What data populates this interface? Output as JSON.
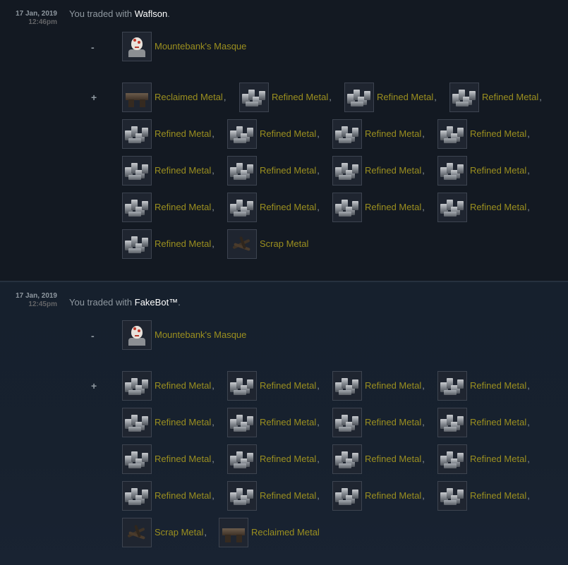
{
  "trades": [
    {
      "date": "17 Jan, 2019",
      "time": "12:46pm",
      "desc_prefix": "You traded with ",
      "partner": "Waflson",
      "desc_suffix": ".",
      "minus_sign": "-",
      "plus_sign": "+",
      "given": [
        {
          "name": "Mountebank's Masque",
          "icon": "masque-icon",
          "comma": ""
        }
      ],
      "received": [
        {
          "name": "Reclaimed Metal",
          "icon": "reclaimed-metal-icon",
          "comma": ","
        },
        {
          "name": "Refined Metal",
          "icon": "refined-metal-icon",
          "comma": ","
        },
        {
          "name": "Refined Metal",
          "icon": "refined-metal-icon",
          "comma": ","
        },
        {
          "name": "Refined Metal",
          "icon": "refined-metal-icon",
          "comma": ","
        },
        {
          "name": "Refined Metal",
          "icon": "refined-metal-icon",
          "comma": ","
        },
        {
          "name": "Refined Metal",
          "icon": "refined-metal-icon",
          "comma": ","
        },
        {
          "name": "Refined Metal",
          "icon": "refined-metal-icon",
          "comma": ","
        },
        {
          "name": "Refined Metal",
          "icon": "refined-metal-icon",
          "comma": ","
        },
        {
          "name": "Refined Metal",
          "icon": "refined-metal-icon",
          "comma": ","
        },
        {
          "name": "Refined Metal",
          "icon": "refined-metal-icon",
          "comma": ","
        },
        {
          "name": "Refined Metal",
          "icon": "refined-metal-icon",
          "comma": ","
        },
        {
          "name": "Refined Metal",
          "icon": "refined-metal-icon",
          "comma": ","
        },
        {
          "name": "Refined Metal",
          "icon": "refined-metal-icon",
          "comma": ","
        },
        {
          "name": "Refined Metal",
          "icon": "refined-metal-icon",
          "comma": ","
        },
        {
          "name": "Refined Metal",
          "icon": "refined-metal-icon",
          "comma": ","
        },
        {
          "name": "Refined Metal",
          "icon": "refined-metal-icon",
          "comma": ","
        },
        {
          "name": "Refined Metal",
          "icon": "refined-metal-icon",
          "comma": ","
        },
        {
          "name": "Scrap Metal",
          "icon": "scrap-metal-icon",
          "comma": ""
        }
      ]
    },
    {
      "date": "17 Jan, 2019",
      "time": "12:45pm",
      "desc_prefix": "You traded with ",
      "partner": "FakeBot™",
      "desc_suffix": ".",
      "minus_sign": "-",
      "plus_sign": "+",
      "given": [
        {
          "name": "Mountebank's Masque",
          "icon": "masque-icon",
          "comma": ""
        }
      ],
      "received": [
        {
          "name": "Refined Metal",
          "icon": "refined-metal-icon",
          "comma": ","
        },
        {
          "name": "Refined Metal",
          "icon": "refined-metal-icon",
          "comma": ","
        },
        {
          "name": "Refined Metal",
          "icon": "refined-metal-icon",
          "comma": ","
        },
        {
          "name": "Refined Metal",
          "icon": "refined-metal-icon",
          "comma": ","
        },
        {
          "name": "Refined Metal",
          "icon": "refined-metal-icon",
          "comma": ","
        },
        {
          "name": "Refined Metal",
          "icon": "refined-metal-icon",
          "comma": ","
        },
        {
          "name": "Refined Metal",
          "icon": "refined-metal-icon",
          "comma": ","
        },
        {
          "name": "Refined Metal",
          "icon": "refined-metal-icon",
          "comma": ","
        },
        {
          "name": "Refined Metal",
          "icon": "refined-metal-icon",
          "comma": ","
        },
        {
          "name": "Refined Metal",
          "icon": "refined-metal-icon",
          "comma": ","
        },
        {
          "name": "Refined Metal",
          "icon": "refined-metal-icon",
          "comma": ","
        },
        {
          "name": "Refined Metal",
          "icon": "refined-metal-icon",
          "comma": ","
        },
        {
          "name": "Refined Metal",
          "icon": "refined-metal-icon",
          "comma": ","
        },
        {
          "name": "Refined Metal",
          "icon": "refined-metal-icon",
          "comma": ","
        },
        {
          "name": "Refined Metal",
          "icon": "refined-metal-icon",
          "comma": ","
        },
        {
          "name": "Refined Metal",
          "icon": "refined-metal-icon",
          "comma": ","
        },
        {
          "name": "Scrap Metal",
          "icon": "scrap-metal-icon",
          "comma": ","
        },
        {
          "name": "Reclaimed Metal",
          "icon": "reclaimed-metal-icon",
          "comma": ""
        }
      ]
    }
  ]
}
